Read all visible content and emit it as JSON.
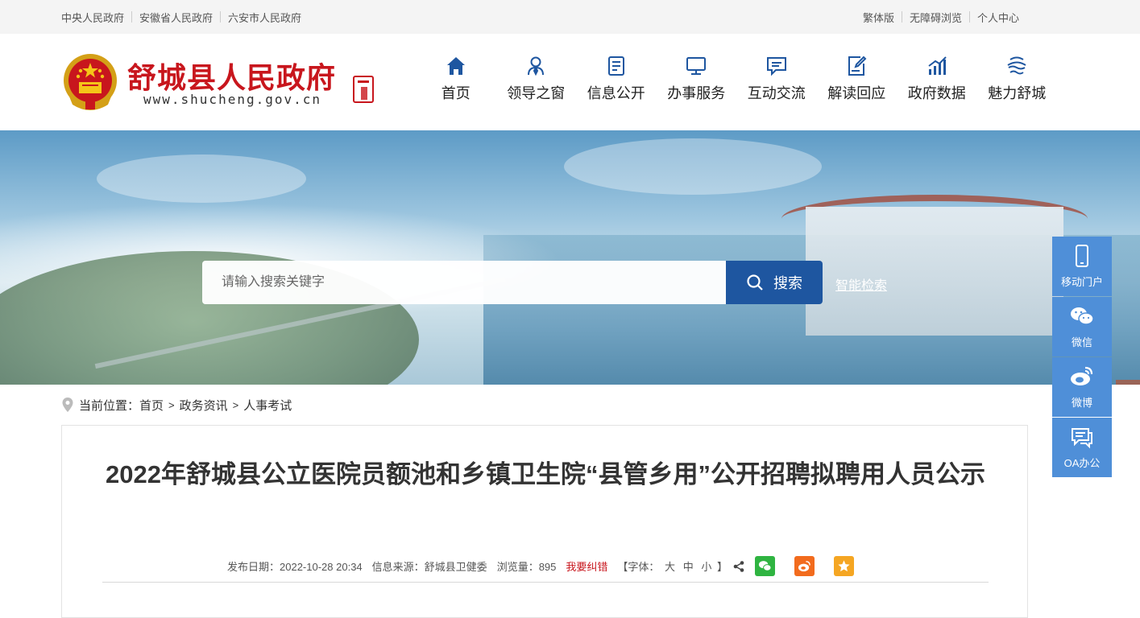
{
  "topbar": {
    "links": [
      "中央人民政府",
      "安徽省人民政府",
      "六安市人民政府"
    ],
    "right": [
      "繁体版",
      "无障碍浏览",
      "个人中心"
    ]
  },
  "header": {
    "site_title": "舒城县人民政府",
    "site_url": "www.shucheng.gov.cn"
  },
  "nav": [
    {
      "label": "首页",
      "icon": "home-icon"
    },
    {
      "label": "领导之窗",
      "icon": "leader-icon"
    },
    {
      "label": "信息公开",
      "icon": "document-icon"
    },
    {
      "label": "办事服务",
      "icon": "monitor-icon"
    },
    {
      "label": "互动交流",
      "icon": "chat-icon"
    },
    {
      "label": "解读回应",
      "icon": "edit-doc-icon"
    },
    {
      "label": "政府数据",
      "icon": "chart-icon"
    },
    {
      "label": "魅力舒城",
      "icon": "landscape-icon"
    }
  ],
  "search": {
    "placeholder": "请输入搜索关键字",
    "button_label": "搜索",
    "smart_search": "智能检索"
  },
  "sidefloat": [
    "移动门户",
    "微信",
    "微博",
    "OA办公"
  ],
  "breadcrumb": {
    "label": "当前位置：",
    "items": [
      "首页",
      "政务资讯",
      "人事考试"
    ],
    "separator": ">"
  },
  "article": {
    "title": "2022年舒城县公立医院员额池和乡镇卫生院“县管乡用”公开招聘拟聘用人员公示",
    "publish_date": "发布日期：2022-10-28 20:34",
    "source": "信息来源：舒城县卫健委",
    "views": "浏览量：895",
    "report_error": "我要纠错",
    "font_size": {
      "open": "【字体：",
      "large": "大",
      "medium": "中",
      "small": "小",
      "close": "】"
    }
  },
  "colors": {
    "brand_red": "#c8161d",
    "primary_blue": "#1e56a0",
    "side_blue": "#4f8fd8",
    "wechat_green": "#2fb441",
    "weibo_orange": "#f26b1d",
    "favorite_orange": "#f5a623"
  }
}
